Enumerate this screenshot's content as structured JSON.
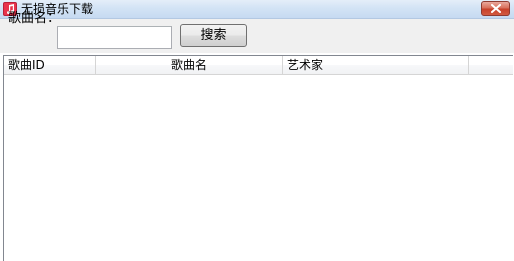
{
  "window": {
    "title": "无损音乐下载",
    "app_icon": "music-note-icon",
    "close_icon": "close-icon"
  },
  "search": {
    "label": "歌曲名：",
    "value": "",
    "placeholder": "",
    "button_label": "搜索"
  },
  "list": {
    "columns": [
      "歌曲ID",
      "歌曲名",
      "艺术家",
      ""
    ],
    "rows": []
  },
  "colors": {
    "titlebar": "#d3e3f5",
    "close_button": "#c7412a",
    "app_icon": "#e8344d",
    "client_background": "#f0f0f0"
  }
}
